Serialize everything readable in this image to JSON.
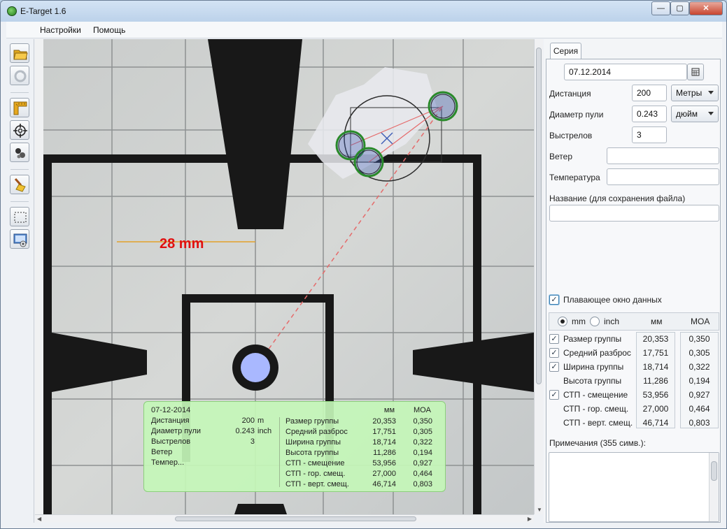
{
  "window": {
    "title": "E-Target 1.6",
    "controls": {
      "minimize": "—",
      "maximize": "▢",
      "close": "✕"
    }
  },
  "menu": {
    "items": [
      "Настройки",
      "Помощь"
    ]
  },
  "toolbar": {
    "tools": [
      "open-folder-icon",
      "refresh-icon",
      "ruler-icon",
      "crosshair-icon",
      "bullet-holes-icon",
      "broom-icon",
      "selection-icon",
      "screenshot-icon"
    ]
  },
  "canvas": {
    "measurement_label": "28 mm",
    "colors": {
      "hole_ring": "#2a8a2a",
      "hole_fill": "#3b5bb5",
      "trajectory": "#e56b6b",
      "aim_point": "#a9b8ff",
      "measure_line": "#e3a12a",
      "measure_text": "#e01010"
    }
  },
  "overlay": {
    "date": "07-12-2014",
    "left_rows": [
      {
        "label": "Дистанция",
        "value": "200",
        "unit": "m"
      },
      {
        "label": "Диаметр пули",
        "value": "0.243",
        "unit": "inch"
      },
      {
        "label": "Выстрелов",
        "value": "3",
        "unit": ""
      },
      {
        "label": "Ветер",
        "value": "",
        "unit": ""
      },
      {
        "label": "Темпер...",
        "value": "",
        "unit": ""
      }
    ],
    "headers": {
      "mm": "мм",
      "moa": "MOA"
    },
    "stats": [
      {
        "label": "Размер группы",
        "mm": "20,353",
        "moa": "0,350"
      },
      {
        "label": "Средний разброс",
        "mm": "17,751",
        "moa": "0,305"
      },
      {
        "label": "Ширина группы",
        "mm": "18,714",
        "moa": "0,322"
      },
      {
        "label": "Высота группы",
        "mm": "11,286",
        "moa": "0,194"
      },
      {
        "label": "СТП - смещение",
        "mm": "53,956",
        "moa": "0,927"
      },
      {
        "label": "СТП - гор. смещ.",
        "mm": "27,000",
        "moa": "0,464"
      },
      {
        "label": "СТП - верт. смещ.",
        "mm": "46,714",
        "moa": "0,803"
      }
    ]
  },
  "panel": {
    "tab": "Серия",
    "date": "07.12.2014",
    "distance": {
      "label": "Дистанция",
      "value": "200",
      "unit": "Метры"
    },
    "bullet": {
      "label": "Диаметр пули",
      "value": "0.243",
      "unit": "дюйм"
    },
    "shots": {
      "label": "Выстрелов",
      "value": "3"
    },
    "wind": {
      "label": "Ветер",
      "value": ""
    },
    "temperature": {
      "label": "Температура",
      "value": ""
    },
    "name": {
      "label": "Название (для сохранения файла)",
      "value": ""
    },
    "floating_window": {
      "label": "Плавающее окно данных",
      "checked": true
    },
    "units": {
      "mm": "mm",
      "inch": "inch",
      "selected": "mm",
      "col_mm": "мм",
      "col_moa": "MOA"
    },
    "stats": [
      {
        "label": "Размер группы",
        "checked": true,
        "mm": "20,353",
        "moa": "0,350"
      },
      {
        "label": "Средний разброс",
        "checked": true,
        "mm": "17,751",
        "moa": "0,305"
      },
      {
        "label": "Ширина группы",
        "checked": true,
        "mm": "18,714",
        "moa": "0,322"
      },
      {
        "label": "Высота группы",
        "checked": false,
        "mm": "11,286",
        "moa": "0,194"
      },
      {
        "label": "СТП - смещение",
        "checked": true,
        "mm": "53,956",
        "moa": "0,927"
      },
      {
        "label": "СТП - гор. смещ.",
        "checked": false,
        "mm": "27,000",
        "moa": "0,464"
      },
      {
        "label": "СТП - верт. смещ.",
        "checked": false,
        "mm": "46,714",
        "moa": "0,803"
      }
    ],
    "notes": {
      "label": "Примечания (355 симв.):",
      "value": ""
    }
  }
}
